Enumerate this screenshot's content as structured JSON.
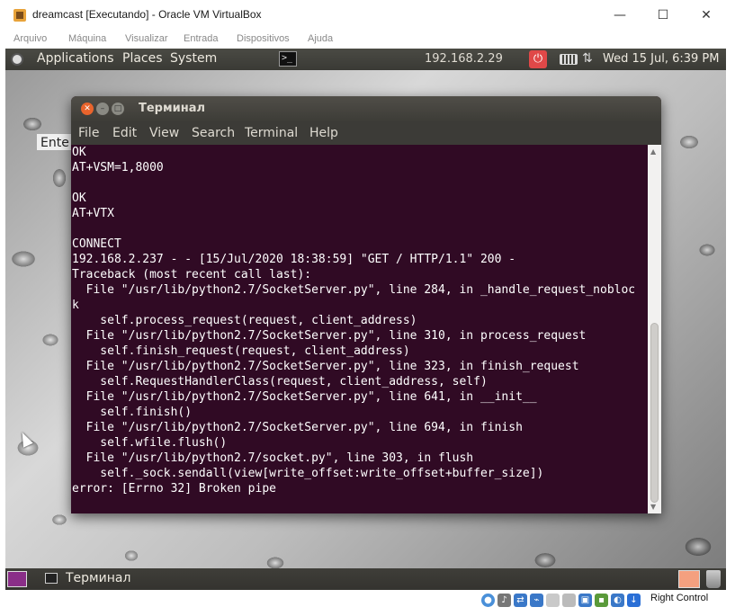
{
  "host": {
    "title": "dreamcast [Executando] - Oracle VM VirtualBox",
    "menus": [
      "Arquivo",
      "Máquina",
      "Visualizar",
      "Entrada",
      "Dispositivos",
      "Ajuda"
    ],
    "window_controls": {
      "minimize": "—",
      "maximize": "☐",
      "close": "✕"
    },
    "status_right_label": "Right Control",
    "status_icons": [
      "optical-drive-icon",
      "audio-icon",
      "network-icon",
      "usb-icon",
      "shared-folder-icon",
      "display-icon",
      "recording-icon",
      "cpu-icon",
      "mouse-integration-icon",
      "arrow-down-icon"
    ]
  },
  "panel": {
    "applications": "Applications",
    "places": "Places",
    "system": "System",
    "terminal_launcher_glyph": ">_",
    "ip": "192.168.2.29",
    "power_glyph": "⏻",
    "network_glyph": "⇅",
    "clock": "Wed 15 Jul,  6:39 PM"
  },
  "behind_window_label": "Ente",
  "terminal": {
    "title": "Терминал",
    "menus": [
      "File",
      "Edit",
      "View",
      "Search",
      "Terminal",
      "Help"
    ],
    "lines": [
      "OK",
      "AT+VSM=1,8000",
      "",
      "OK",
      "AT+VTX",
      "",
      "CONNECT",
      "192.168.2.237 - - [15/Jul/2020 18:38:59] \"GET / HTTP/1.1\" 200 -",
      "Traceback (most recent call last):",
      "  File \"/usr/lib/python2.7/SocketServer.py\", line 284, in _handle_request_nobloc",
      "k",
      "    self.process_request(request, client_address)",
      "  File \"/usr/lib/python2.7/SocketServer.py\", line 310, in process_request",
      "    self.finish_request(request, client_address)",
      "  File \"/usr/lib/python2.7/SocketServer.py\", line 323, in finish_request",
      "    self.RequestHandlerClass(request, client_address, self)",
      "  File \"/usr/lib/python2.7/SocketServer.py\", line 641, in __init__",
      "    self.finish()",
      "  File \"/usr/lib/python2.7/SocketServer.py\", line 694, in finish",
      "    self.wfile.flush()",
      "  File \"/usr/lib/python2.7/socket.py\", line 303, in flush",
      "    self._sock.sendall(view[write_offset:write_offset+buffer_size])",
      "error: [Errno 32] Broken pipe"
    ]
  },
  "taskbar": {
    "task_label": "Терминал"
  },
  "colors": {
    "terminal_bg": "#300a24",
    "panel_bg": "#3c3b37",
    "close_button": "#e9642c",
    "power_button": "#e04848"
  }
}
